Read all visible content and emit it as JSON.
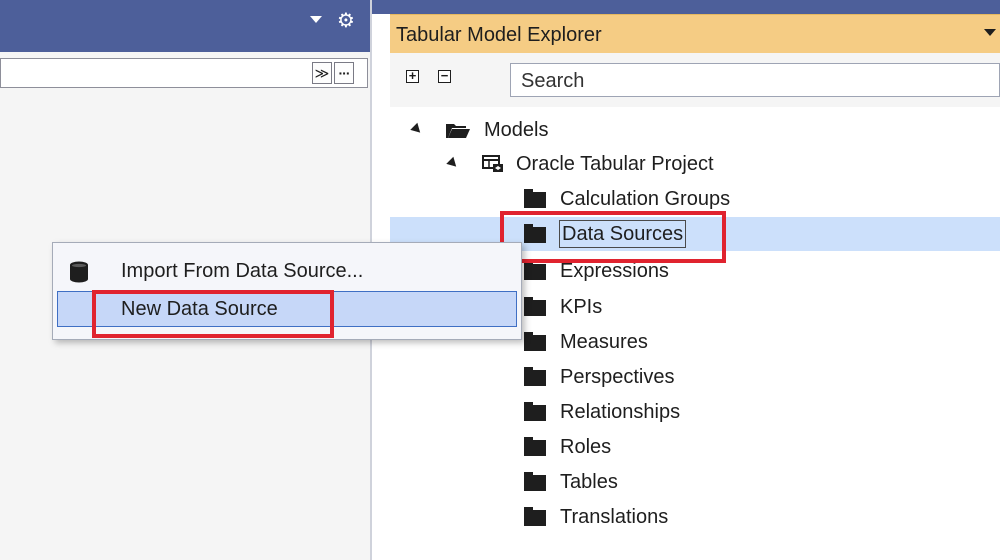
{
  "left_pane": {
    "gear_glyph": "⚙",
    "combo_buttons": [
      "≫",
      "···"
    ]
  },
  "explorer": {
    "title": "Tabular Model Explorer",
    "search_placeholder": "Search",
    "expand_all_glyph": "+",
    "collapse_all_glyph": "−",
    "tree": {
      "root": "Models",
      "project": "Oracle Tabular Project",
      "folders": [
        "Calculation Groups",
        "Data Sources",
        "Expressions",
        "KPIs",
        "Measures",
        "Perspectives",
        "Relationships",
        "Roles",
        "Tables",
        "Translations"
      ],
      "selected": "Data Sources"
    }
  },
  "context_menu": {
    "items": [
      {
        "label": "Import From Data Source...",
        "icon": "database-icon"
      },
      {
        "label": "New Data Source",
        "icon": ""
      }
    ],
    "highlighted": "New Data Source"
  },
  "colors": {
    "header_blue": "#4d5f9a",
    "title_gold": "#f5cc84",
    "selection": "#cce0fb",
    "annotation_red": "#e0232f"
  }
}
